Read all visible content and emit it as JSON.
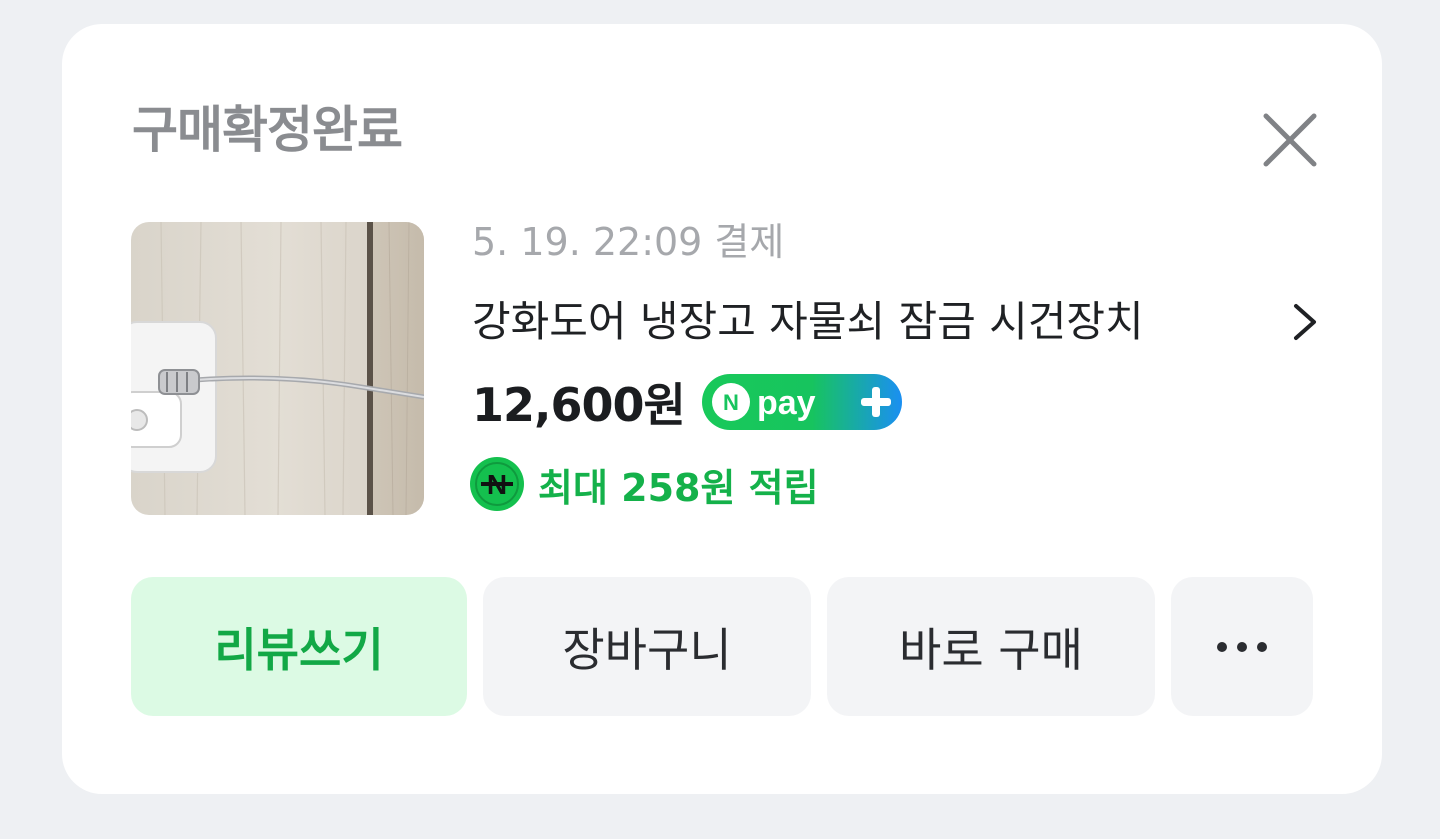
{
  "card": {
    "title": "구매확정완료",
    "close_icon": "close-icon"
  },
  "order": {
    "meta": "5. 19. 22:09 결제",
    "product_name": "강화도어 냉장고 자물쇠 잠금 시건장치",
    "price": "12,600원",
    "npay_badge": "Npay+",
    "points": "최대 258원 적립",
    "product_image_icon": "product-thumbnail-door-lock",
    "chevron_icon": "chevron-right-icon"
  },
  "actions": {
    "review": "리뷰쓰기",
    "cart": "장바구니",
    "buy_now": "바로 구매",
    "more_icon": "more-horizontal-icon"
  },
  "colors": {
    "accent_green": "#14b14a",
    "review_bg": "#dcfae4",
    "button_bg": "#f3f4f6",
    "npay_blue": "#1d8ef5"
  }
}
